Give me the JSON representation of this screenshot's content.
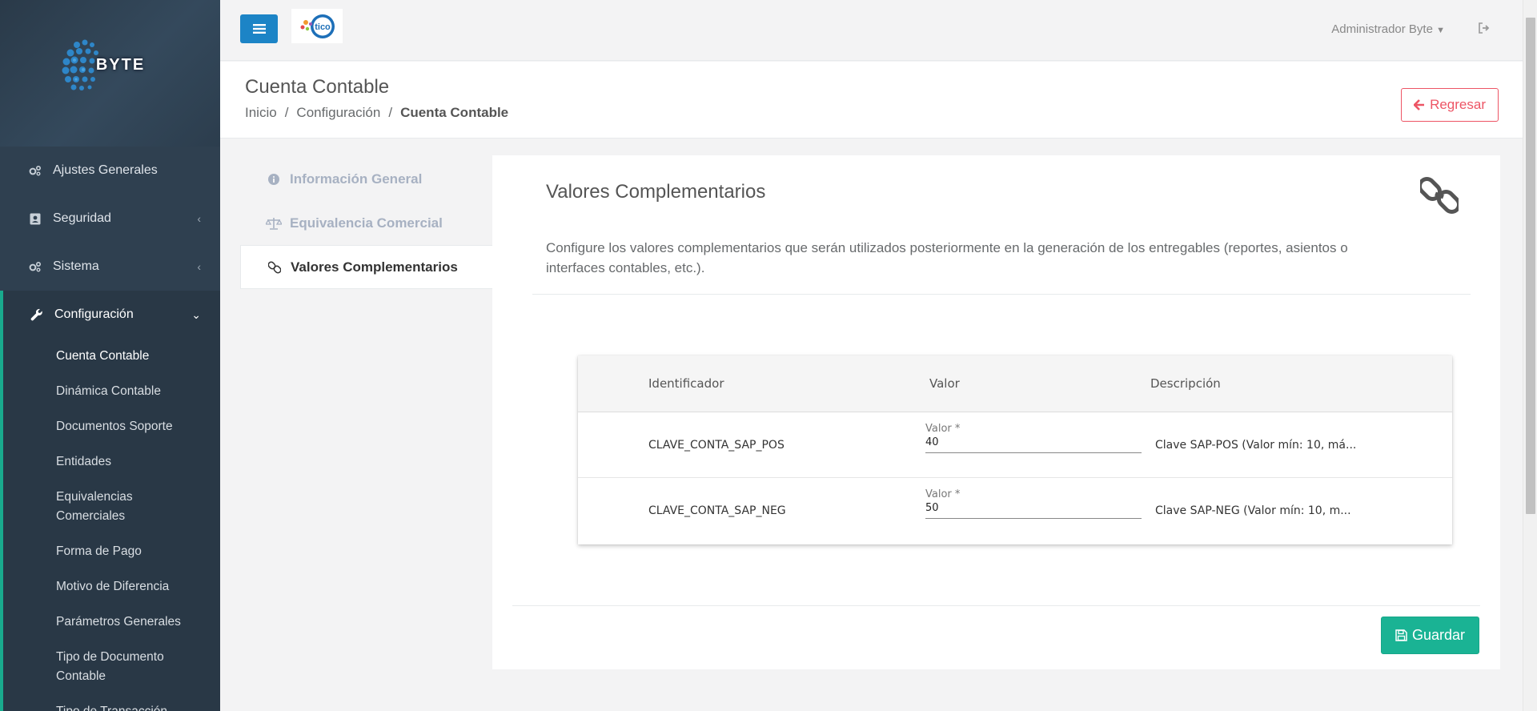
{
  "brand": {
    "logo_text": "BYTE"
  },
  "sidebar": {
    "items": [
      {
        "label": "Ajustes Generales",
        "icon": "gears-icon"
      },
      {
        "label": "Seguridad",
        "icon": "id-card-icon"
      },
      {
        "label": "Sistema",
        "icon": "gears-icon"
      }
    ],
    "config_group": {
      "label": "Configuración",
      "icon": "wrench-icon",
      "subitems": [
        "Cuenta Contable",
        "Dinámica Contable",
        "Documentos Soporte",
        "Entidades",
        "Equivalencias Comerciales",
        "Forma de Pago",
        "Motivo de Diferencia",
        "Parámetros Generales",
        "Tipo de Documento Contable",
        "Tipo de Transacción"
      ],
      "active": "Cuenta Contable"
    }
  },
  "topbar": {
    "partner_logo": "tico",
    "user_label": "Administrador Byte"
  },
  "heading": {
    "title": "Cuenta Contable",
    "breadcrumb": [
      "Inicio",
      "Configuración",
      "Cuenta Contable"
    ],
    "back_label": "Regresar"
  },
  "tabs": [
    {
      "label": "Información General",
      "icon": "info-circle-icon"
    },
    {
      "label": "Equivalencia Comercial",
      "icon": "balance-scale-icon"
    },
    {
      "label": "Valores Complementarios",
      "icon": "chain-link-icon"
    }
  ],
  "panel": {
    "title": "Valores Complementarios",
    "description": "Configure los valores complementarios que serán utilizados posteriormente en la generación de los entregables (reportes, asientos o interfaces contables, etc.).",
    "table": {
      "headers": [
        "Identificador",
        "Valor",
        "Descripción"
      ],
      "rows": [
        {
          "id": "CLAVE_CONTA_SAP_POS",
          "field_label": "Valor *",
          "value": "40",
          "description": "Clave SAP-POS (Valor mín: 10, má..."
        },
        {
          "id": "CLAVE_CONTA_SAP_NEG",
          "field_label": "Valor *",
          "value": "50",
          "description": "Clave SAP-NEG (Valor mín: 10, m..."
        }
      ]
    },
    "save_label": "Guardar"
  },
  "colors": {
    "sidebar_bg": "#2f4050",
    "accent_green": "#1ab394",
    "primary_blue": "#1c84c6",
    "danger_red": "#ed5565"
  }
}
